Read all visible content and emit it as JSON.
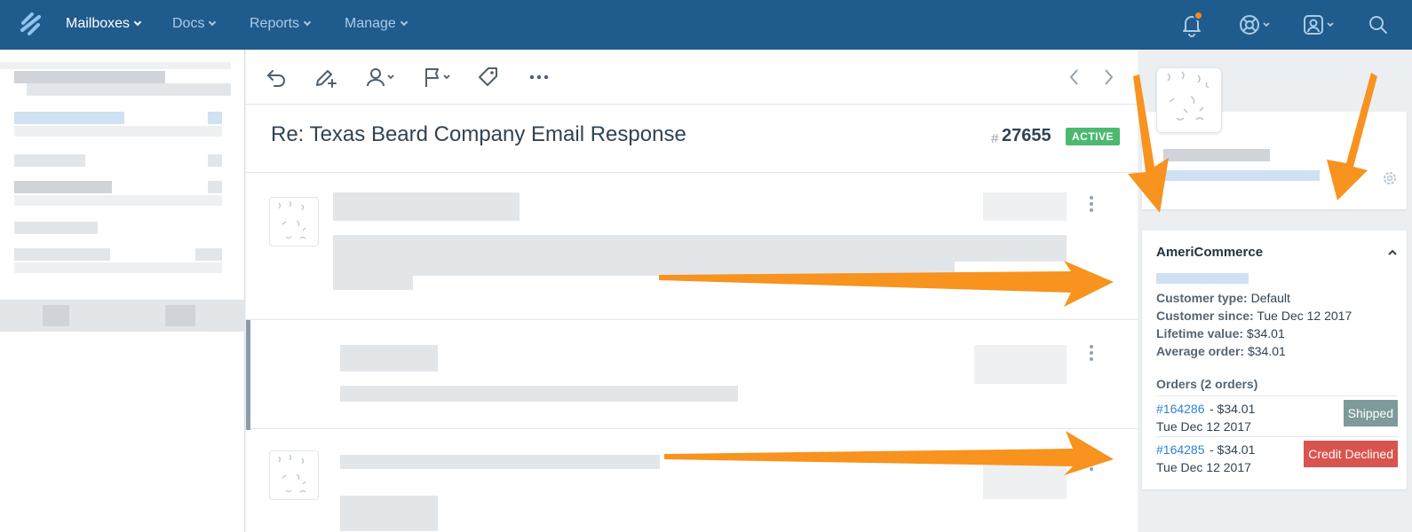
{
  "nav": {
    "items": [
      {
        "label": "Mailboxes",
        "active": true
      },
      {
        "label": "Docs",
        "active": false
      },
      {
        "label": "Reports",
        "active": false
      },
      {
        "label": "Manage",
        "active": false
      }
    ],
    "icons": [
      "notifications-bell-icon",
      "help-lifebuoy-icon",
      "user-profile-icon",
      "search-icon"
    ],
    "notification_dot_color": "#f68a1e",
    "bar_color": "#1f5b8c"
  },
  "toolbar": {
    "icons": [
      "reply-icon",
      "note-pencil-icon",
      "assign-user-icon",
      "flag-status-icon",
      "tag-icon",
      "more-options-icon"
    ],
    "nav_icons": [
      "previous-chevron-icon",
      "next-chevron-icon"
    ]
  },
  "conversation": {
    "subject": "Re: Texas Beard Company Email Response",
    "number_prefix": "#",
    "number": "27655",
    "status": "ACTIVE",
    "status_color": "#4cb96f"
  },
  "americommerce": {
    "title": "AmeriCommerce",
    "fields": [
      {
        "label": "Customer type:",
        "value": "Default"
      },
      {
        "label": "Customer since:",
        "value": "Tue Dec 12 2017"
      },
      {
        "label": "Lifetime value:",
        "value": "$34.01"
      },
      {
        "label": "Average order:",
        "value": "$34.01"
      }
    ],
    "orders_heading": "Orders (2 orders)",
    "orders": [
      {
        "number": "#164286",
        "amount": "- $34.01",
        "date": "Tue Dec 12 2017",
        "status": "Shipped",
        "status_color": "#7e9a9a"
      },
      {
        "number": "#164285",
        "amount": "- $34.01",
        "date": "Tue Dec 12 2017",
        "status": "Credit Declined",
        "status_color": "#d9534f"
      }
    ]
  },
  "colors": {
    "arrow": "#f7931e",
    "link": "#2f83d2"
  }
}
